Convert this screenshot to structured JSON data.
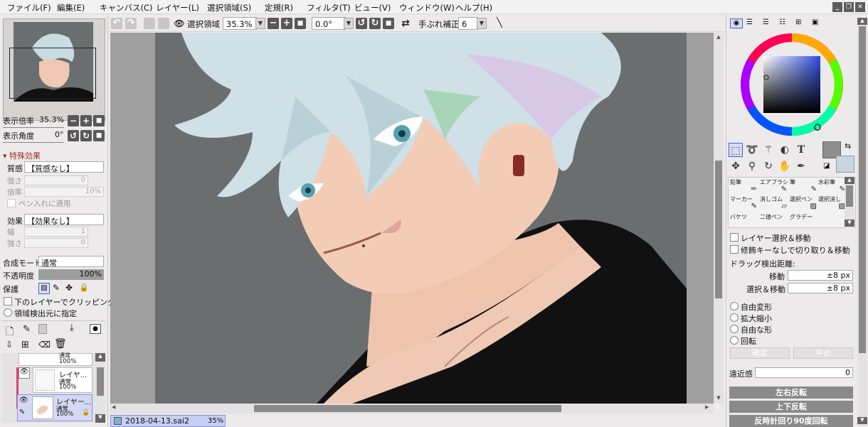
{
  "menu": [
    "ファイル(F)",
    "編集(E)",
    "キャンバス(C)",
    "レイヤー(L)",
    "選択領域(S)",
    "定規(R)",
    "フィルタ(T)",
    "ビュー(V)",
    "ウィンドウ(W)",
    "ヘルプ(H)"
  ],
  "toolbar": {
    "selection_label": "選択領域",
    "zoom": "35.3%",
    "rotation": "0.0°",
    "stabilizer_label": "手ぶれ補正",
    "stabilizer": "6"
  },
  "navigator": {
    "zoom_label": "表示倍率",
    "zoom_value": "35.3%",
    "angle_label": "表示角度",
    "angle_value": "0°"
  },
  "effects": {
    "section": "特殊効果",
    "texture_label": "質感",
    "texture_value": "【質感なし】",
    "strength_label": "強さ",
    "strength_value": "0",
    "scale_label": "倍率",
    "scale_value": "10%",
    "pen_apply": "ペン入れに適用",
    "effect_label": "効果",
    "effect_value": "【効果なし】",
    "width_label": "幅",
    "width_value": "1",
    "strength2_label": "強さ",
    "strength2_value": "0"
  },
  "layer_props": {
    "blend_label": "合成モード",
    "blend_value": "通常",
    "opacity_label": "不透明度",
    "opacity_value": "100%",
    "protect_label": "保護",
    "clip_label": "下のレイヤーでクリッピング",
    "region_label": "領域検出元に指定"
  },
  "layers": [
    {
      "name": "",
      "mode": "通常",
      "opacity": "100%"
    },
    {
      "name": "レイヤ...",
      "mode": "通常",
      "opacity": "100%"
    },
    {
      "name": "レイヤー...",
      "mode": "通常",
      "opacity": "100%"
    }
  ],
  "tabs": [
    {
      "title": "2018-04-13.sai2",
      "zoom": "35%"
    }
  ],
  "brushes": [
    [
      "鉛筆",
      "エアブラシ",
      "筆",
      "水彩筆"
    ],
    [
      "マーカー",
      "消しゴム",
      "選択ペン",
      "選択消し"
    ],
    [
      "バケツ",
      "二値ペン",
      "グラデー",
      ""
    ]
  ],
  "transform": {
    "layer_select_move": "レイヤー選択＆移動",
    "cut_move": "修飾キーなしで切り取り＆移動",
    "drag_label": "ドラッグ検出距離:",
    "move_label": "移動",
    "move_value": "±8 px",
    "select_move_label": "選択＆移動",
    "select_move_value": "±8 px",
    "options": [
      "自由変形",
      "拡大縮小",
      "自由な形",
      "回転"
    ],
    "ok": "確定",
    "cancel": "中止",
    "perspective_label": "遠近感",
    "perspective_value": "0",
    "flip_h": "左右反転",
    "flip_v": "上下反転",
    "rotate_ccw": "反時計回り90度回転"
  },
  "colors": {
    "fg": "#8e8e8e",
    "bg": "#c6d6de",
    "accent": "#4b5fd0"
  }
}
